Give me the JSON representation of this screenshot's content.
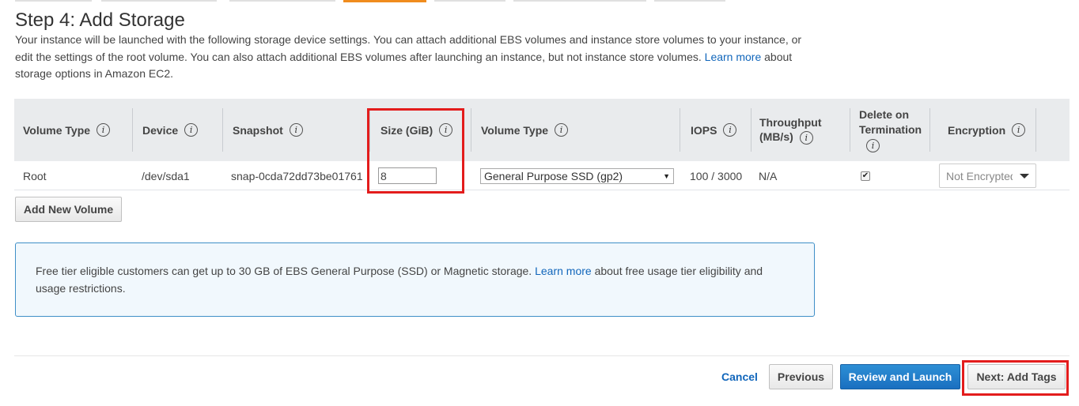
{
  "page": {
    "title": "Step 4: Add Storage",
    "description_part1": "Your instance will be launched with the following storage device settings. You can attach additional EBS volumes and instance store volumes to your instance, or edit the settings of the root volume. You can also attach additional EBS volumes after launching an instance, but not instance store volumes.",
    "description_link": "Learn more",
    "description_part2": "about storage options in Amazon EC2."
  },
  "table": {
    "headers": {
      "volume_type": "Volume Type",
      "device": "Device",
      "snapshot": "Snapshot",
      "size": "Size (GiB)",
      "volume_type2": "Volume Type",
      "iops": "IOPS",
      "throughput_line1": "Throughput",
      "throughput_line2": "(MB/s)",
      "delete_line1": "Delete on",
      "delete_line2": "Termination",
      "encryption": "Encryption"
    },
    "info_glyph": "i",
    "row": {
      "volume_type": "Root",
      "device": "/dev/sda1",
      "snapshot": "snap-0cda72dd73be01761",
      "size": "8",
      "volume_type_select": "General Purpose SSD (gp2)",
      "iops": "100 / 3000",
      "throughput": "N/A",
      "delete_on_termination": true,
      "encryption": "Not Encrypted"
    }
  },
  "buttons": {
    "add_volume": "Add New Volume",
    "cancel": "Cancel",
    "previous": "Previous",
    "review": "Review and Launch",
    "next": "Next: Add Tags"
  },
  "notice": {
    "part1": "Free tier eligible customers can get up to 30 GB of EBS General Purpose (SSD) or Magnetic storage.",
    "link": "Learn more",
    "part2": "about free usage tier eligibility and usage restrictions."
  },
  "icons": {
    "select_caret": "▼",
    "checkbox_check": "✔"
  },
  "colors": {
    "link": "#1166bb",
    "primary_button": "#1a6fc0",
    "highlight": "#e31c1c",
    "active_step": "#f08c1e"
  }
}
